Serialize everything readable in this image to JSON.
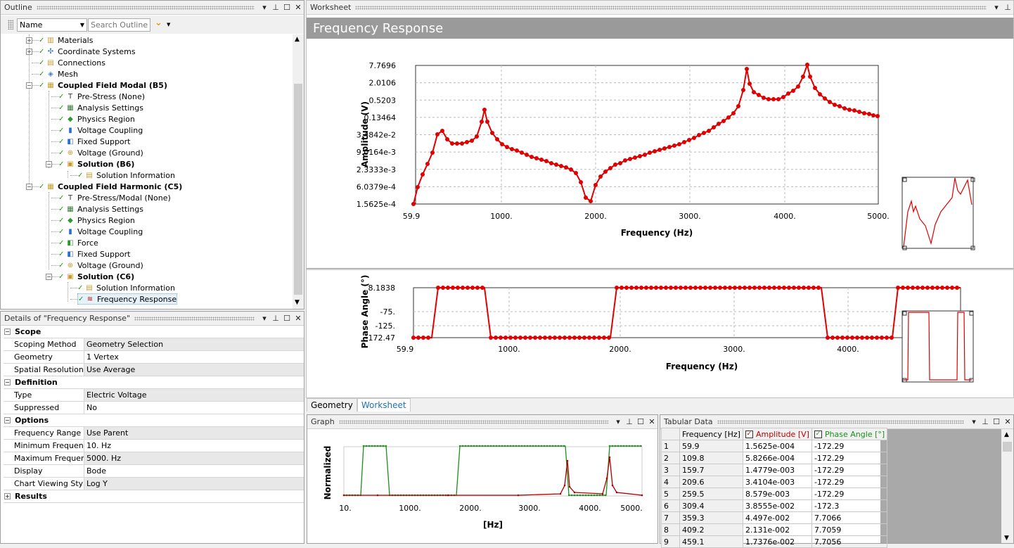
{
  "outline": {
    "title": "Outline",
    "name_select": "Name",
    "search_placeholder": "Search Outline",
    "items": [
      {
        "label": "Materials",
        "bold": false
      },
      {
        "label": "Coordinate Systems",
        "bold": false
      },
      {
        "label": "Connections",
        "bold": false
      },
      {
        "label": "Mesh",
        "bold": false
      },
      {
        "label": "Coupled Field Modal (B5)",
        "bold": true
      },
      {
        "label": "Pre-Stress (None)",
        "bold": false
      },
      {
        "label": "Analysis Settings",
        "bold": false
      },
      {
        "label": "Physics Region",
        "bold": false
      },
      {
        "label": "Voltage Coupling",
        "bold": false
      },
      {
        "label": "Fixed Support",
        "bold": false
      },
      {
        "label": "Voltage (Ground)",
        "bold": false
      },
      {
        "label": "Solution (B6)",
        "bold": true
      },
      {
        "label": "Solution Information",
        "bold": false
      },
      {
        "label": "Coupled Field Harmonic (C5)",
        "bold": true
      },
      {
        "label": "Pre-Stress/Modal (None)",
        "bold": false
      },
      {
        "label": "Analysis Settings",
        "bold": false
      },
      {
        "label": "Physics Region",
        "bold": false
      },
      {
        "label": "Voltage Coupling",
        "bold": false
      },
      {
        "label": "Force",
        "bold": false
      },
      {
        "label": "Fixed Support",
        "bold": false
      },
      {
        "label": "Voltage (Ground)",
        "bold": false
      },
      {
        "label": "Solution (C6)",
        "bold": true
      },
      {
        "label": "Solution Information",
        "bold": false
      },
      {
        "label": "Frequency Response",
        "bold": false
      }
    ]
  },
  "details": {
    "title": "Details of \"Frequency Response\"",
    "sections": [
      {
        "name": "Scope",
        "rows": [
          [
            "Scoping Method",
            "Geometry Selection"
          ],
          [
            "Geometry",
            "1 Vertex"
          ],
          [
            "Spatial Resolution",
            "Use Average"
          ]
        ]
      },
      {
        "name": "Definition",
        "rows": [
          [
            "Type",
            "Electric Voltage"
          ],
          [
            "Suppressed",
            "No"
          ]
        ]
      },
      {
        "name": "Options",
        "rows": [
          [
            "Frequency Range",
            "Use Parent"
          ],
          [
            "Minimum Frequency",
            "10. Hz"
          ],
          [
            "Maximum Frequency",
            "5000. Hz"
          ],
          [
            "Display",
            "Bode"
          ],
          [
            "Chart Viewing Style",
            "Log Y"
          ]
        ]
      },
      {
        "name": "Results",
        "rows": []
      }
    ]
  },
  "worksheet": {
    "pane_title": "Worksheet",
    "header": "Frequency Response",
    "amp_ylabel": "Amplitude (V)",
    "amp_xlabel": "Frequency (Hz)",
    "amp_yticks": [
      "7.7696",
      "2.0106",
      "0.5203",
      "0.13464",
      "3.4842e-2",
      "9.0164e-3",
      "2.3333e-3",
      "6.0379e-4",
      "1.5625e-4"
    ],
    "amp_xticks": [
      "59.9",
      "1000.",
      "2000.",
      "3000.",
      "4000.",
      "5000."
    ],
    "phase_ylabel": "Phase Angle (°)",
    "phase_xlabel": "Frequency (Hz)",
    "phase_yticks": [
      "8.1838",
      "-75.",
      "-125.",
      "-172.47"
    ],
    "phase_xticks": [
      "59.9",
      "1000.",
      "2000.",
      "3000.",
      "4000."
    ]
  },
  "bottom_tabs": [
    "Geometry",
    "Worksheet"
  ],
  "graph": {
    "title": "Graph",
    "ylabel": "Normalized",
    "xlabel": "[Hz]",
    "xticks": [
      "10.",
      "1000.",
      "2000.",
      "3000.",
      "4000.",
      "5000."
    ]
  },
  "tabular": {
    "title": "Tabular Data",
    "headers": [
      "Frequency [Hz]",
      "Amplitude [V]",
      "Phase Angle [°]"
    ],
    "rows": [
      [
        "1",
        "59.9",
        "1.5625e-004",
        "-172.29"
      ],
      [
        "2",
        "109.8",
        "5.8266e-004",
        "-172.29"
      ],
      [
        "3",
        "159.7",
        "1.4779e-003",
        "-172.29"
      ],
      [
        "4",
        "209.6",
        "3.4104e-003",
        "-172.29"
      ],
      [
        "5",
        "259.5",
        "8.579e-003",
        "-172.29"
      ],
      [
        "6",
        "309.4",
        "3.8555e-002",
        "-172.3"
      ],
      [
        "7",
        "359.3",
        "4.497e-002",
        "7.7066"
      ],
      [
        "8",
        "409.2",
        "2.131e-002",
        "7.7059"
      ],
      [
        "9",
        "459.1",
        "1.7376e-002",
        "7.7056"
      ]
    ]
  },
  "colors": {
    "curve": "#e00000",
    "phase_green": "#1a8f1a",
    "header_gray": "#9a9a9a",
    "tab_blue": "#1e72b8"
  }
}
